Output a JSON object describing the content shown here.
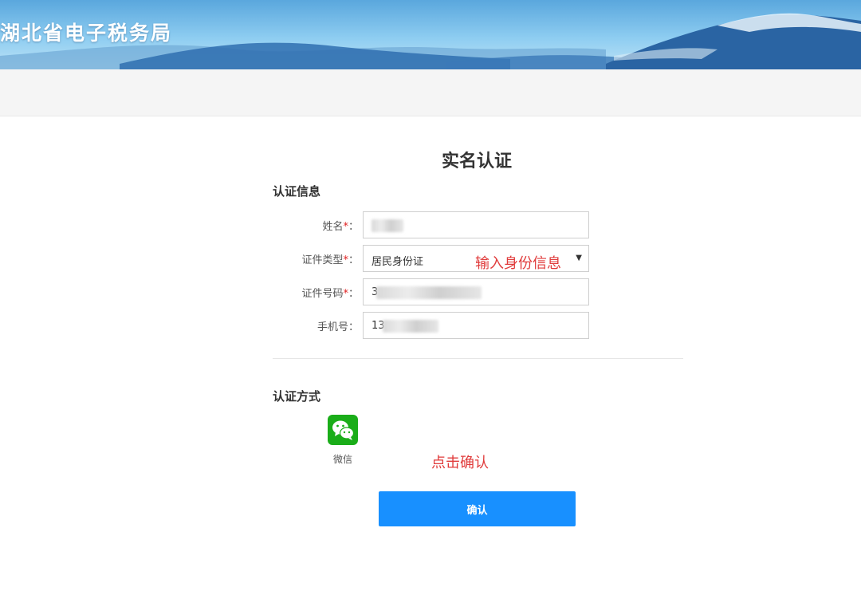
{
  "header": {
    "site_title": "湖北省电子税务局"
  },
  "page": {
    "title": "实名认证"
  },
  "auth_info": {
    "section_title": "认证信息",
    "fields": [
      {
        "label": "姓名",
        "required": true,
        "value": ""
      },
      {
        "label": "证件类型",
        "required": true,
        "value": "居民身份证"
      },
      {
        "label": "证件号码",
        "required": true,
        "value": "3"
      },
      {
        "label": "手机号",
        "required": false,
        "value": "13"
      }
    ],
    "colon": "："
  },
  "auth_method": {
    "section_title": "认证方式",
    "options": [
      {
        "label": "微信",
        "icon": "wechat-icon",
        "color": "#1aad19"
      }
    ]
  },
  "confirm_button": {
    "label": "确认",
    "color": "#1890ff"
  },
  "annotations": {
    "input_hint": "输入身份信息",
    "click_hint": "点击确认",
    "color": "#e03b3b"
  }
}
